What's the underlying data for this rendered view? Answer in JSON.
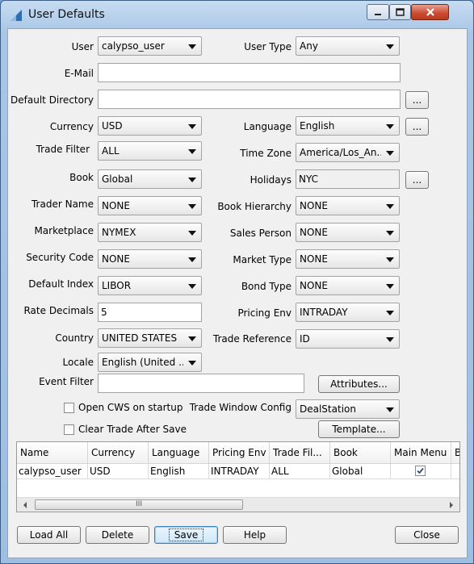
{
  "window": {
    "title": "User Defaults"
  },
  "labels": {
    "user": "User",
    "user_type": "User Type",
    "email": "E-Mail",
    "default_directory": "Default Directory",
    "currency": "Currency",
    "language": "Language",
    "trade_filter": "Trade Filter",
    "time_zone": "Time Zone",
    "book": "Book",
    "holidays": "Holidays",
    "trader_name": "Trader Name",
    "book_hierarchy": "Book Hierarchy",
    "marketplace": "Marketplace",
    "sales_person": "Sales Person",
    "security_code": "Security Code",
    "market_type": "Market Type",
    "default_index": "Default Index",
    "bond_type": "Bond Type",
    "rate_decimals": "Rate Decimals",
    "pricing_env": "Pricing Env",
    "country": "Country",
    "trade_reference": "Trade Reference",
    "locale": "Locale",
    "event_filter": "Event Filter",
    "open_cws": "Open CWS on startup",
    "trade_window_config": "Trade Window Config",
    "clear_trade": "Clear Trade After Save"
  },
  "values": {
    "user": "calypso_user",
    "user_type": "Any",
    "email": "",
    "default_directory": "",
    "currency": "USD",
    "language": "English",
    "trade_filter": "ALL",
    "time_zone": "America/Los_An...",
    "book": "Global",
    "holidays": "NYC",
    "trader_name": "NONE",
    "book_hierarchy": "NONE",
    "marketplace": "NYMEX",
    "sales_person": "NONE",
    "security_code": "NONE",
    "market_type": "NONE",
    "default_index": "LIBOR",
    "bond_type": "NONE",
    "rate_decimals": "5",
    "pricing_env": "INTRADAY",
    "country": "UNITED STATES",
    "trade_reference": "ID",
    "locale": "English (United ...",
    "event_filter": "",
    "trade_window_config": "DealStation",
    "open_cws_checked": false,
    "clear_trade_checked": false
  },
  "buttons": {
    "ellipsis": "...",
    "attributes": "Attributes...",
    "template": "Template...",
    "load_all": "Load All",
    "delete": "Delete",
    "save": "Save",
    "help": "Help",
    "close": "Close"
  },
  "table": {
    "columns": [
      "Name",
      "Currency",
      "Language",
      "Pricing Env",
      "Trade Fil...",
      "Book",
      "Main Menu",
      "B"
    ],
    "rows": [
      {
        "name": "calypso_user",
        "currency": "USD",
        "language": "English",
        "pricing_env": "INTRADAY",
        "trade_filter": "ALL",
        "book": "Global",
        "main_menu": true
      }
    ],
    "scroll_thumb_grip": "III"
  },
  "colors": {
    "title_bar": "#a9c6e6",
    "close_button": "#c94a2f",
    "focus_button": "#3c7fb1"
  }
}
